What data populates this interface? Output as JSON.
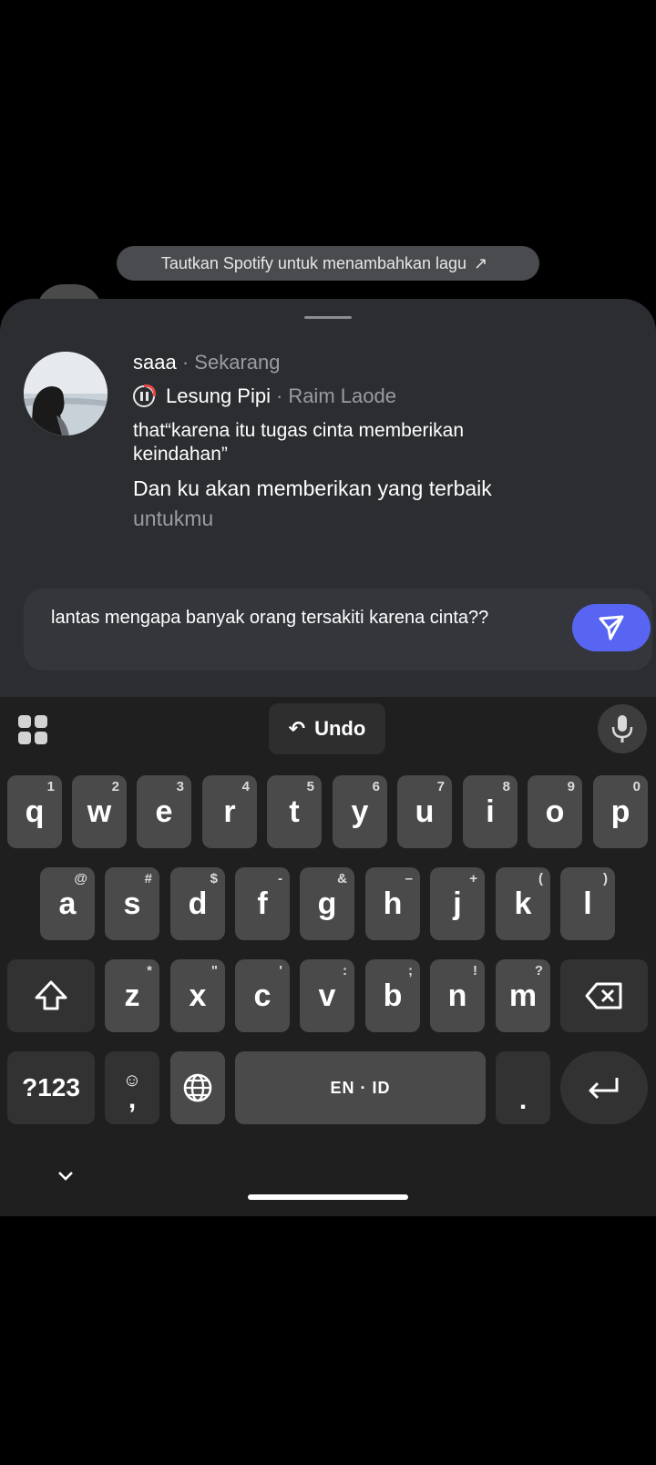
{
  "top_pill": {
    "label": "Tautkan Spotify untuk menambahkan lagu",
    "arrow": "↗"
  },
  "post": {
    "username": "saaa",
    "separator": "·",
    "time": "Sekarang",
    "song_title": "Lesung Pipi",
    "song_artist": "Raim Laode",
    "message": "that“karena itu tugas cinta memberikan keindahan”",
    "lyric_active": "Dan ku akan memberikan yang terbaik",
    "lyric_next": "untukmu"
  },
  "reply": {
    "text": "lantas mengapa banyak orang tersakiti karena cinta??"
  },
  "keyboard": {
    "undo_label": "Undo",
    "row1": [
      {
        "k": "q",
        "h": "1"
      },
      {
        "k": "w",
        "h": "2"
      },
      {
        "k": "e",
        "h": "3"
      },
      {
        "k": "r",
        "h": "4"
      },
      {
        "k": "t",
        "h": "5"
      },
      {
        "k": "y",
        "h": "6"
      },
      {
        "k": "u",
        "h": "7"
      },
      {
        "k": "i",
        "h": "8"
      },
      {
        "k": "o",
        "h": "9"
      },
      {
        "k": "p",
        "h": "0"
      }
    ],
    "row2": [
      {
        "k": "a",
        "h": "@"
      },
      {
        "k": "s",
        "h": "#"
      },
      {
        "k": "d",
        "h": "$"
      },
      {
        "k": "f",
        "h": "-"
      },
      {
        "k": "g",
        "h": "&"
      },
      {
        "k": "h",
        "h": "–"
      },
      {
        "k": "j",
        "h": "+"
      },
      {
        "k": "k",
        "h": "("
      },
      {
        "k": "l",
        "h": ")"
      }
    ],
    "row3": [
      {
        "k": "z",
        "h": "*"
      },
      {
        "k": "x",
        "h": "\""
      },
      {
        "k": "c",
        "h": "'"
      },
      {
        "k": "v",
        "h": ":"
      },
      {
        "k": "b",
        "h": ";"
      },
      {
        "k": "n",
        "h": "!"
      },
      {
        "k": "m",
        "h": "?"
      }
    ],
    "symbols_label": "?123",
    "comma_label": ",",
    "space_label": "EN · ID",
    "period_label": "."
  }
}
